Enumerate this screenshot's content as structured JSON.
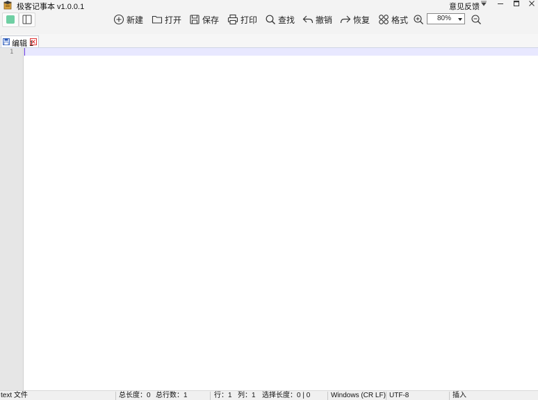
{
  "window": {
    "title": "极客记事本 v1.0.0.1",
    "feedback": "意见反馈",
    "controls": {
      "menu": "▾",
      "minimize": "—",
      "maximize": "□",
      "close": "✕"
    }
  },
  "toolbar": {
    "new_label": "新建",
    "open_label": "打开",
    "save_label": "保存",
    "print_label": "打印",
    "find_label": "查找",
    "undo_label": "撤销",
    "redo_label": "恢复",
    "format_label": "格式",
    "zoom_value": "80%"
  },
  "tabs": [
    {
      "label": "编辑 1",
      "active": true
    }
  ],
  "editor": {
    "line_numbers": [
      "1"
    ]
  },
  "status": {
    "file_type": "text 文件",
    "total_length": "总长度：0",
    "total_lines": "总行数：1",
    "row": "行：1",
    "col": "列：1",
    "selection": "选择长度：0 | 0",
    "eol": "Windows (CR LF)",
    "encoding": "UTF-8",
    "insert_mode": "插入"
  },
  "colors": {
    "accent": "#6fcfa3",
    "current_line": "#e8e8ff",
    "caret": "#6a3ad8",
    "tab_close": "#d33333"
  }
}
